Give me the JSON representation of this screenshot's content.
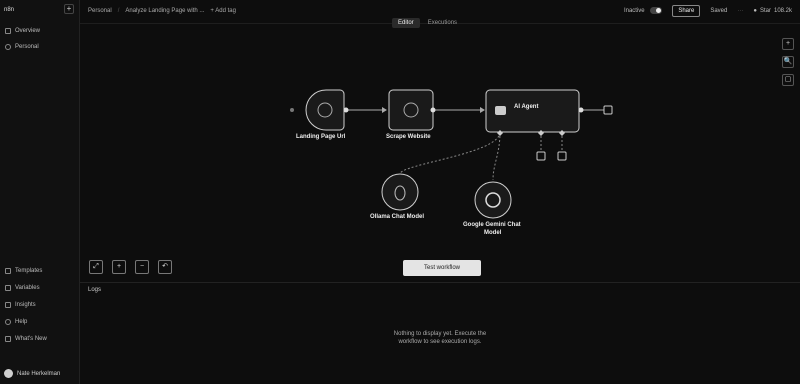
{
  "sidebar": {
    "logo": "n8n",
    "add_label": "+",
    "top_items": [
      {
        "label": "Overview",
        "icon": "home-icon"
      },
      {
        "label": "Personal",
        "icon": "user-icon"
      }
    ],
    "bottom_items": [
      {
        "label": "Templates",
        "icon": "template-icon"
      },
      {
        "label": "Variables",
        "icon": "variable-icon"
      },
      {
        "label": "Insights",
        "icon": "chart-icon"
      },
      {
        "label": "Help",
        "icon": "help-icon"
      },
      {
        "label": "What's New",
        "icon": "bell-icon"
      }
    ],
    "user_name": "Nate Herkelman"
  },
  "header": {
    "crumb_project": "Personal",
    "crumb_workflow": "Analyze Landing Page with ...",
    "crumb_tags": "+ Add tag",
    "inactive_label": "Inactive",
    "share_label": "Share",
    "save_label": "Saved",
    "star_label": "Star",
    "star_count": "108.2k"
  },
  "tabs": [
    {
      "label": "Editor",
      "active": true
    },
    {
      "label": "Executions",
      "active": false
    }
  ],
  "rail": [
    "+",
    "🔍",
    "▢"
  ],
  "nodes": {
    "trigger_label": "Landing Page Url",
    "scrape_label": "Scrape Website",
    "agent_label": "AI Agent",
    "ollama_label": "Ollama Chat Model",
    "gemini_label_line1": "Google Gemini Chat",
    "gemini_label_line2": "Model"
  },
  "controls": [
    "⤢",
    "+",
    "−",
    "↶"
  ],
  "test_button": "Test workflow",
  "logs": {
    "label": "Logs",
    "message_line1": "Nothing to display yet. Execute the",
    "message_line2": "workflow to see execution logs."
  },
  "colors": {
    "background": "#0d0d0d",
    "node_fill": "#1a1a1a",
    "node_stroke": "#cfcfcf",
    "accent": "#e4e4e4"
  }
}
